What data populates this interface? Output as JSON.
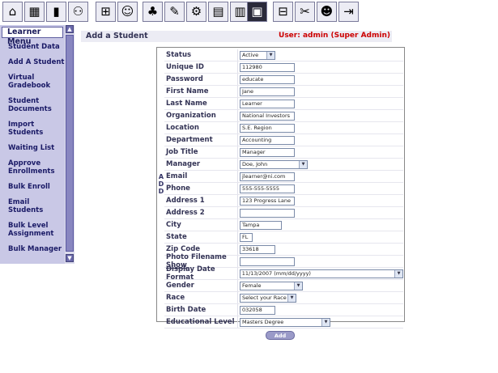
{
  "toolbar": {
    "group1": [
      "house-icon",
      "gradebook-icon",
      "book-icon",
      "people-icon"
    ],
    "group2": [
      "org-chart-icon",
      "users-icon"
    ],
    "group3": [
      "group-icon",
      "pen-icon",
      "tools-icon",
      "books-icon",
      "calendar-icon"
    ],
    "group4": [
      "reports-icon"
    ],
    "group5": [
      "network-icon",
      "scissors-icon",
      "admin-icon",
      "logout-icon"
    ]
  },
  "sidebar": {
    "header": "Learner Menu",
    "items": [
      "Student Data",
      "Add A Student",
      "Virtual Gradebook",
      "Student Documents",
      "Import Students",
      "Waiting List",
      "Approve Enrollments",
      "Bulk Enroll",
      "Email Students",
      "Bulk Level Assignment",
      "Bulk Manager"
    ]
  },
  "page": {
    "title": "Add a Student",
    "user_info": "User: admin  (Super Admin)",
    "side_label": "A D D"
  },
  "form": {
    "status": {
      "label": "Status",
      "value": "Active"
    },
    "unique_id": {
      "label": "Unique ID",
      "value": "112980"
    },
    "password": {
      "label": "Password",
      "value": "educate"
    },
    "first_name": {
      "label": "First Name",
      "value": "Jane"
    },
    "last_name": {
      "label": "Last Name",
      "value": "Learner"
    },
    "organization": {
      "label": "Organization",
      "value": "National Investors"
    },
    "location": {
      "label": "Location",
      "value": "S.E. Region"
    },
    "department": {
      "label": "Department",
      "value": "Accounting"
    },
    "job_title": {
      "label": "Job Title",
      "value": "Manager"
    },
    "manager": {
      "label": "Manager",
      "value": "Doe, John"
    },
    "email": {
      "label": "Email",
      "value": "jlearner@ni.com"
    },
    "phone": {
      "label": "Phone",
      "value": "555-555-5555"
    },
    "address1": {
      "label": "Address 1",
      "value": "123 Progress Lane"
    },
    "address2": {
      "label": "Address 2",
      "value": ""
    },
    "city": {
      "label": "City",
      "value": "Tampa"
    },
    "state": {
      "label": "State",
      "value": "FL"
    },
    "zip": {
      "label": "Zip Code",
      "value": "33618"
    },
    "photo": {
      "label": "Photo Filename",
      "link": "Show",
      "value": ""
    },
    "date_format": {
      "label": "Display Date Format",
      "value": "11/13/2007 (mm/dd/yyyy)"
    },
    "gender": {
      "label": "Gender",
      "value": "Female"
    },
    "race": {
      "label": "Race",
      "value": "Select your Race"
    },
    "birth_date": {
      "label": "Birth Date",
      "value": "032058"
    },
    "education": {
      "label": "Educational Level",
      "value": "Masters Degree"
    }
  },
  "buttons": {
    "add": "Add"
  }
}
